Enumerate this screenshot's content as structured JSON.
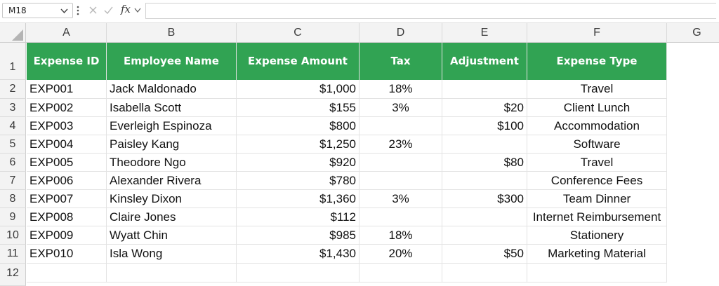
{
  "formula_bar": {
    "name_box": "M18",
    "fx_label": "fx",
    "formula": ""
  },
  "columns": [
    "A",
    "B",
    "C",
    "D",
    "E",
    "F",
    "G"
  ],
  "rows": [
    "1",
    "2",
    "3",
    "4",
    "5",
    "6",
    "7",
    "8",
    "9",
    "10",
    "11",
    "12"
  ],
  "table": {
    "header_color": "#31a353",
    "headers": [
      "Expense ID",
      "Employee Name",
      "Expense Amount",
      "Tax",
      "Adjustment",
      "Expense Type"
    ],
    "rows": [
      [
        "EXP001",
        "Jack Maldonado",
        "$1,000",
        "18%",
        "",
        "Travel"
      ],
      [
        "EXP002",
        "Isabella Scott",
        "$155",
        "3%",
        "$20",
        "Client Lunch"
      ],
      [
        "EXP003",
        "Everleigh Espinoza",
        "$800",
        "",
        "$100",
        "Accommodation"
      ],
      [
        "EXP004",
        "Paisley Kang",
        "$1,250",
        "23%",
        "",
        "Software"
      ],
      [
        "EXP005",
        "Theodore Ngo",
        "$920",
        "",
        "$80",
        "Travel"
      ],
      [
        "EXP006",
        "Alexander Rivera",
        "$780",
        "",
        "",
        "Conference Fees"
      ],
      [
        "EXP007",
        "Kinsley Dixon",
        "$1,360",
        "3%",
        "$300",
        "Team Dinner"
      ],
      [
        "EXP008",
        "Claire Jones",
        "$112",
        "",
        "",
        "Internet Reimbursement"
      ],
      [
        "EXP009",
        "Wyatt Chin",
        "$985",
        "18%",
        "",
        "Stationery"
      ],
      [
        "EXP010",
        "Isla Wong",
        "$1,430",
        "20%",
        "$50",
        "Marketing Material"
      ]
    ]
  }
}
